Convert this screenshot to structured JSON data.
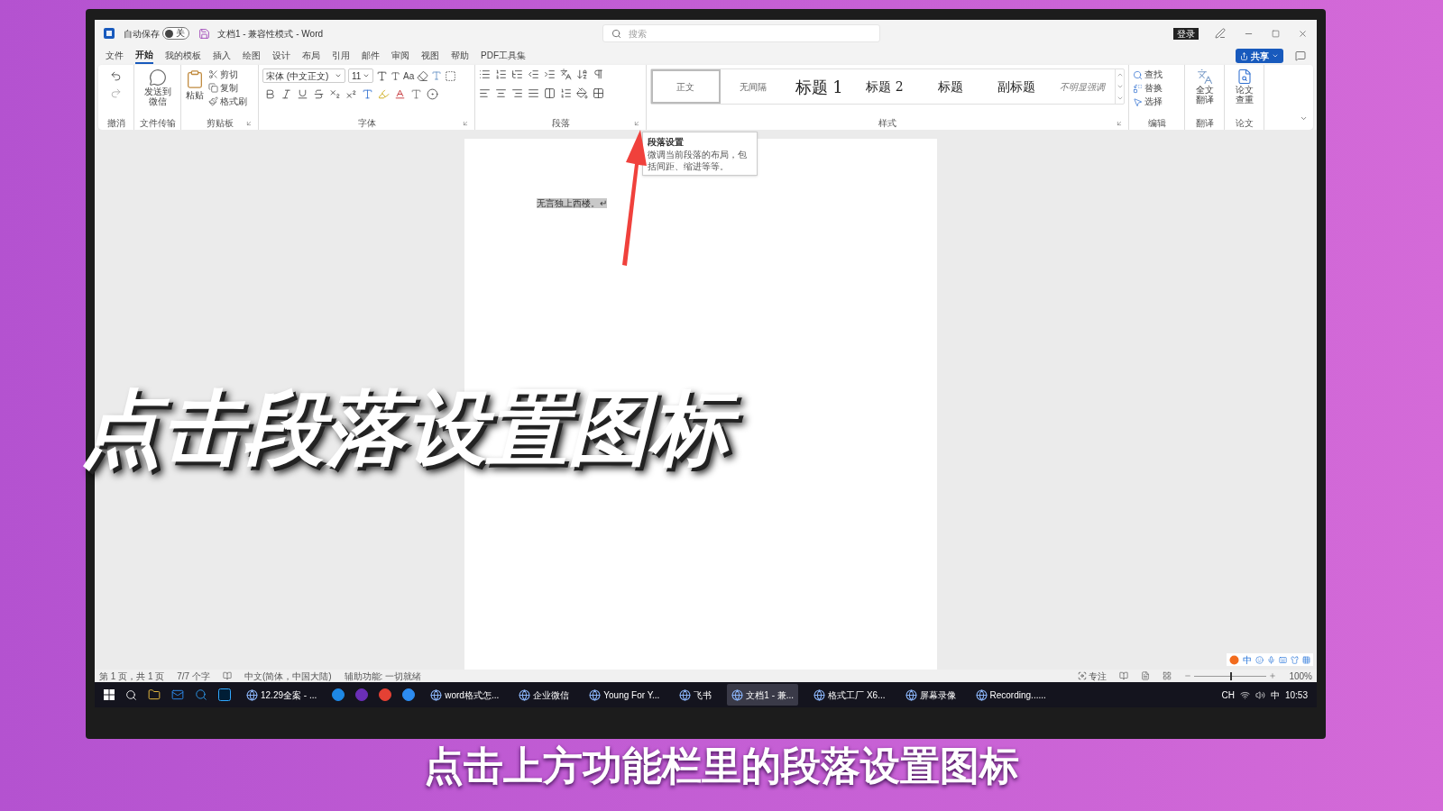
{
  "title_bar": {
    "autosave_label": "自动保存",
    "autosave_switch": {
      "on": false,
      "label": "关"
    },
    "document_title": "文档1 - 兼容性模式 - Word",
    "search": {
      "placeholder": "搜索"
    },
    "login_button": "登录"
  },
  "menu_tabs": [
    {
      "label": "文件",
      "selected": false
    },
    {
      "label": "开始",
      "selected": true
    },
    {
      "label": "我的模板",
      "selected": false
    },
    {
      "label": "插入",
      "selected": false
    },
    {
      "label": "绘图",
      "selected": false
    },
    {
      "label": "设计",
      "selected": false
    },
    {
      "label": "布局",
      "selected": false
    },
    {
      "label": "引用",
      "selected": false
    },
    {
      "label": "邮件",
      "selected": false
    },
    {
      "label": "审阅",
      "selected": false
    },
    {
      "label": "视图",
      "selected": false
    },
    {
      "label": "帮助",
      "selected": false
    },
    {
      "label": "PDF工具集",
      "selected": false
    }
  ],
  "share_button": "共享",
  "ribbon_groups": [
    {
      "kind": "undo",
      "label": "撤消"
    },
    {
      "kind": "transfer",
      "label": "文件传输",
      "buttons": [
        "发送到微信"
      ]
    },
    {
      "kind": "clipboard",
      "label": "剪贴板",
      "buttons": [
        "粘贴",
        "剪切",
        "复制",
        "格式刷"
      ]
    },
    {
      "kind": "font",
      "label": "字体",
      "font_name": "宋体 (中文正文)",
      "font_size": "11",
      "case_button": "Aa"
    },
    {
      "kind": "paragraph",
      "label": "段落"
    },
    {
      "kind": "styles",
      "label": "样式",
      "styles": [
        {
          "label": "正文",
          "selected": true
        },
        {
          "label": "无间隔",
          "selected": false
        },
        {
          "label": "标题 1",
          "selected": false
        },
        {
          "label": "标题 2",
          "selected": false
        },
        {
          "label": "标题",
          "selected": false
        },
        {
          "label": "副标题",
          "selected": false
        },
        {
          "label": "不明显强调",
          "selected": false
        }
      ]
    },
    {
      "kind": "editing",
      "label": "编辑",
      "buttons": [
        "查找",
        "替换",
        "选择"
      ]
    },
    {
      "kind": "translate",
      "label": "翻译",
      "buttons": [
        "全文翻译"
      ]
    },
    {
      "kind": "thesis",
      "label": "论文",
      "buttons": [
        "论文查重"
      ]
    }
  ],
  "tooltip": {
    "title": "段落设置",
    "text": "微调当前段落的布局，包括间距、缩进等等。"
  },
  "document": {
    "text": "无言独上西楼。",
    "paragraph_mark": "↵"
  },
  "ime_toolbar": {
    "mode": "中"
  },
  "status_bar": {
    "page": "第 1 页，共 1 页",
    "words": "7/7 个字",
    "language": "中文(简体，中国大陆)",
    "accessibility": "辅助功能: 一切就绪",
    "focus": "专注",
    "zoom": {
      "level": 0.5,
      "label": "100%"
    }
  },
  "taskbar": {
    "apps": [
      {
        "kind": "app",
        "label": "12.29全案 - ...",
        "selected": false
      },
      {
        "kind": "pin",
        "selected": false
      },
      {
        "kind": "pin",
        "selected": false
      },
      {
        "kind": "pin",
        "selected": false
      },
      {
        "kind": "pin",
        "selected": false
      },
      {
        "kind": "app",
        "label": "word格式怎...",
        "selected": false
      },
      {
        "kind": "app",
        "label": "企业微信",
        "selected": false
      },
      {
        "kind": "app",
        "label": "Young For Y...",
        "selected": false
      },
      {
        "kind": "app",
        "label": "飞书",
        "selected": false
      },
      {
        "kind": "app",
        "label": "文档1 - 兼...",
        "selected": true
      },
      {
        "kind": "app",
        "label": "格式工厂 X6...",
        "selected": false
      },
      {
        "kind": "app",
        "label": "屏幕录像",
        "selected": false
      },
      {
        "kind": "app",
        "label": "Recording......",
        "selected": false
      }
    ],
    "tray": {
      "language": "CH",
      "ime": "中",
      "clock": "10:53"
    }
  },
  "overlay_caption": "点击段落设置图标",
  "subtitle": "点击上方功能栏里的段落设置图标"
}
